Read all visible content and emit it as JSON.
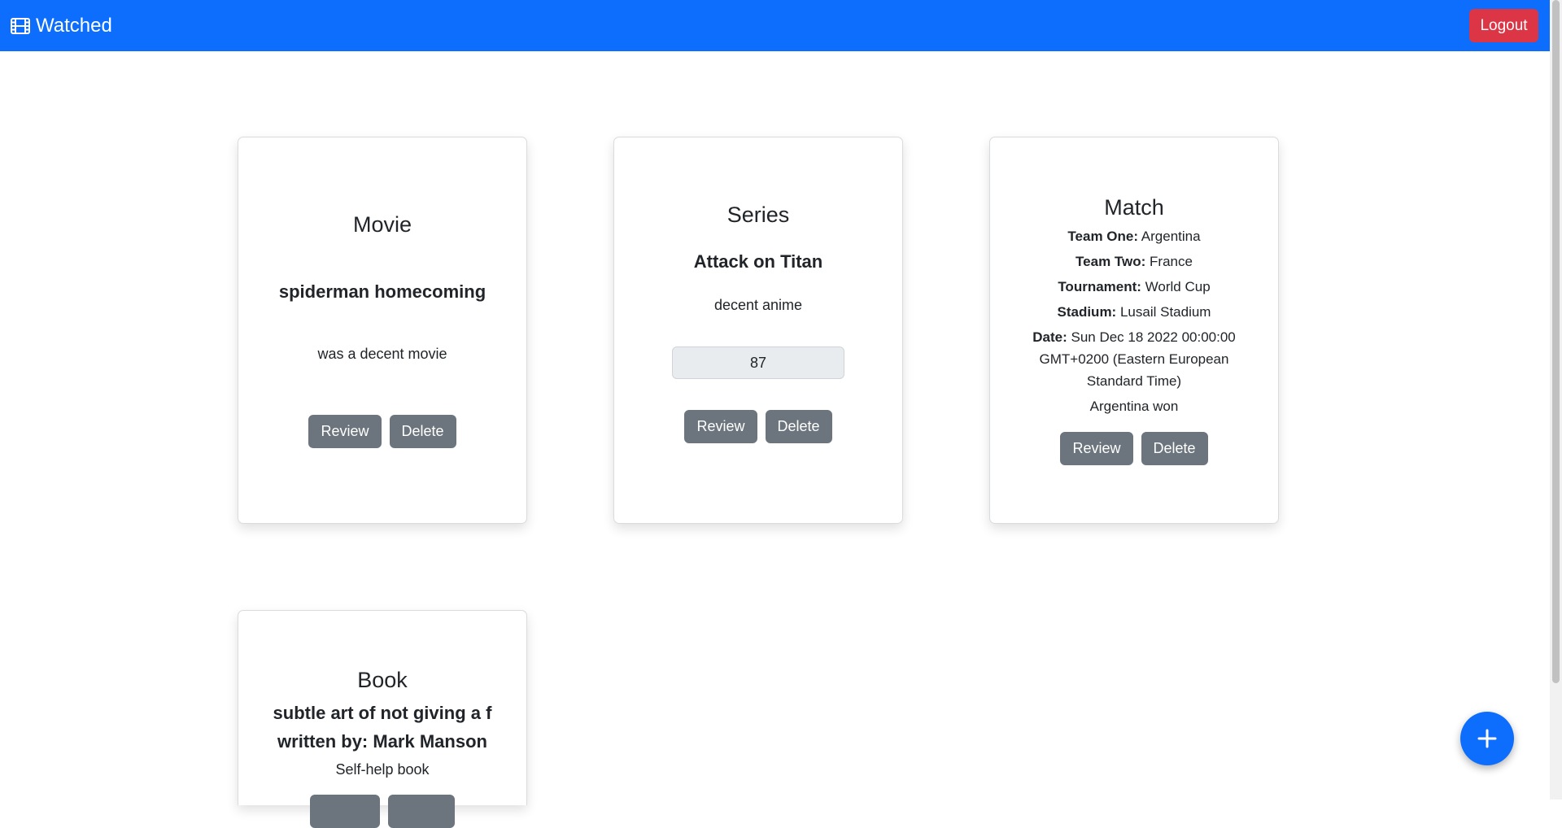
{
  "navbar": {
    "brand": "Watched",
    "brand_icon": "film-icon",
    "logout_label": "Logout",
    "color": "#0d6efd"
  },
  "cards": {
    "movie": {
      "kind": "Movie",
      "title": "spiderman homecoming",
      "description": "was a decent movie",
      "review_label": "Review",
      "delete_label": "Delete"
    },
    "series": {
      "kind": "Series",
      "title": "Attack on Titan",
      "description": "decent anime",
      "rating": "87",
      "review_label": "Review",
      "delete_label": "Delete"
    },
    "match": {
      "kind": "Match",
      "team_one_label": "Team One:",
      "team_one": "Argentina",
      "team_two_label": "Team Two:",
      "team_two": "France",
      "tournament_label": "Tournament:",
      "tournament": "World Cup",
      "stadium_label": "Stadium:",
      "stadium": "Lusail Stadium",
      "date_label": "Date:",
      "date_line1": "Sun Dec 18 2022 00:00:00",
      "date_line2": "GMT+0200 (Eastern European",
      "date_line3": "Standard Time)",
      "result": "Argentina won",
      "review_label": "Review",
      "delete_label": "Delete"
    },
    "book": {
      "kind": "Book",
      "title": "subtle art of not giving a f",
      "author_line": "written by: Mark Manson",
      "description": "Self-help book"
    }
  },
  "fab": {
    "icon": "plus-icon"
  }
}
